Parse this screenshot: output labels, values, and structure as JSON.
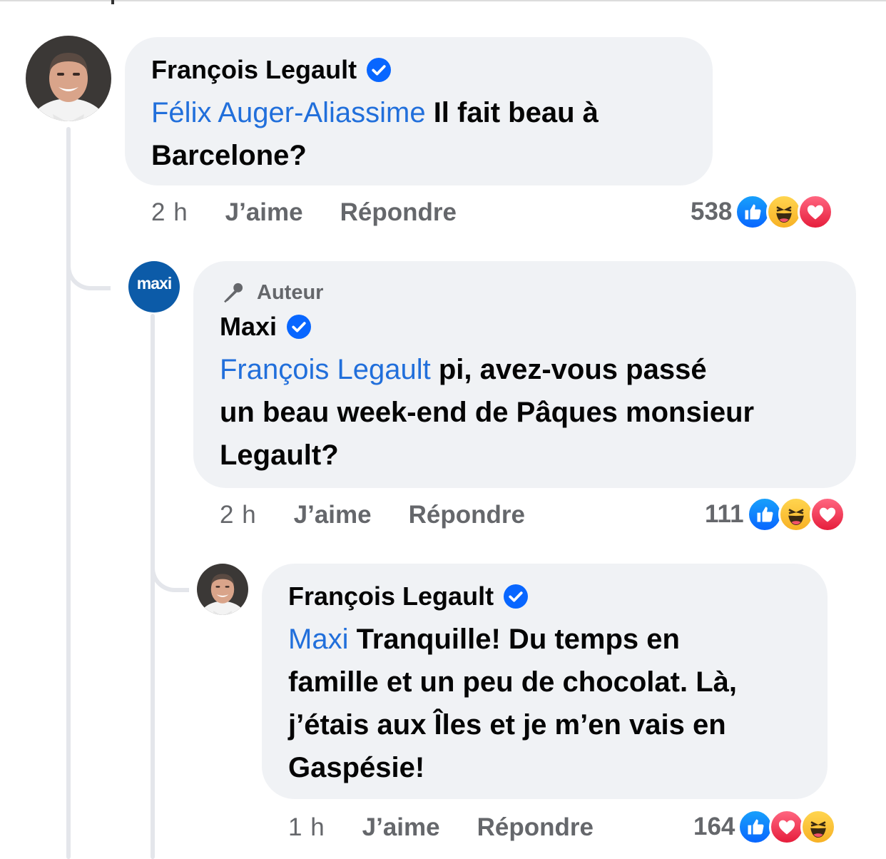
{
  "comments": [
    {
      "author": "François Legault",
      "mention": "Félix Auger-Aliassime",
      "text_line1": " Il fait beau à",
      "text_line2": "Barcelone?",
      "time": "2 h",
      "like_label": "J’aime",
      "reply_label": "Répondre",
      "reaction_count": "538",
      "reactions": [
        "like-icon",
        "haha-icon",
        "love-icon"
      ]
    },
    {
      "badge": "Auteur",
      "author": "Maxi",
      "avatar_text": "maxi",
      "mention": "François Legault",
      "text_line1": " pi, avez-vous passé",
      "text_line2": "un beau week-end de Pâques monsieur",
      "text_line3": "Legault?",
      "time": "2 h",
      "like_label": "J’aime",
      "reply_label": "Répondre",
      "reaction_count": "111",
      "reactions": [
        "like-icon",
        "haha-icon",
        "love-icon"
      ]
    },
    {
      "author": "François Legault",
      "mention": "Maxi",
      "text_line1": " Tranquille! Du temps en",
      "text_line2": "famille et un peu de chocolat. Là,",
      "text_line3": "j’étais aux Îles et je m’en vais en",
      "text_line4": "Gaspésie!",
      "time": "1 h",
      "like_label": "J’aime",
      "reply_label": "Répondre",
      "reaction_count": "164",
      "reactions": [
        "like-icon",
        "love-icon",
        "haha-icon"
      ]
    }
  ],
  "colors": {
    "bubble": "#f0f2f5",
    "mention": "#216fdb",
    "meta": "#65676b",
    "verified": "#0866ff",
    "maxi_blue": "#0c5ba8"
  }
}
